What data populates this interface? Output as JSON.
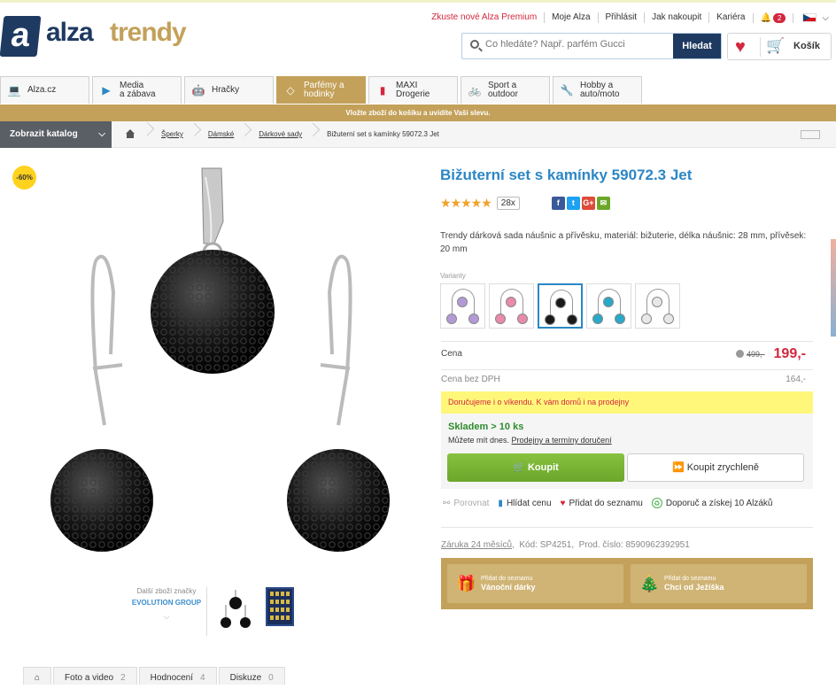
{
  "header": {
    "logo_letter": "a",
    "logo_word1": "alza",
    "logo_word2": "trendy",
    "links": [
      "Zkuste nové Alza Premium",
      "Moje Alza",
      "Přihlásit",
      "Jak nakoupit",
      "Kariéra"
    ],
    "notif_count": "2",
    "search_placeholder": "Co hledáte? Např. parfém Gucci",
    "search_button": "Hledat",
    "cart_label": "Košík"
  },
  "categories": [
    {
      "label": "Alza.cz",
      "icon": "laptop-icon",
      "color": "#1f3a60"
    },
    {
      "label": "Media\na zábava",
      "icon": "play-icon",
      "color": "#2b87c5"
    },
    {
      "label": "Hračky",
      "icon": "robot-icon",
      "color": "#e67e22"
    },
    {
      "label": "Parfémy a\nhodinky",
      "icon": "diamond-icon",
      "color": "#ffffff"
    },
    {
      "label": "MAXI\nDrogerie",
      "icon": "spray-icon",
      "color": "#d3273e"
    },
    {
      "label": "Sport a\noutdoor",
      "icon": "bike-icon",
      "color": "#6ca62a"
    },
    {
      "label": "Hobby a\nauto/moto",
      "icon": "drill-icon",
      "color": "#8b4513"
    }
  ],
  "active_category": 3,
  "promo": "Vložte zboží do košíku a uvidíte Vaši slevu.",
  "catalog_button": "Zobrazit katalog",
  "breadcrumbs": [
    "Šperky",
    "Dámské",
    "Dárkové sady",
    "Bižuterní set s kamínky 59072.3 Jet"
  ],
  "discount_badge": "-60%",
  "product": {
    "title": "Bižuterní set s kamínky 59072.3 Jet",
    "rating_count": "28x",
    "rating_stars": 5,
    "description": "Trendy dárková sada náušnic a přívěsku, materiál: bižuterie, délka náušnic: 28 mm, přívěsek: 20 mm",
    "variants_label": "Varianty",
    "variants": [
      {
        "color": "#b39ad6"
      },
      {
        "color": "#e98aa8"
      },
      {
        "color": "#1a1a1a"
      },
      {
        "color": "#2aa8c8"
      },
      {
        "color": "#e8e8e8"
      }
    ],
    "selected_variant": 2,
    "price_label": "Cena",
    "old_price": "499,-",
    "price": "199,-",
    "price_novat_label": "Cena bez DPH",
    "price_novat": "164,-",
    "delivery_note": "Doručujeme i o víkendu. K vám domů i na prodejny",
    "stock": "Skladem > 10 ks",
    "pickup_text": "Můžete mít dnes.",
    "pickup_link": "Prodejny a termíny doručení",
    "buy_button": "Koupit",
    "quick_buy_button": "Koupit zrychleně",
    "actions": {
      "compare": "Porovnat",
      "watch_price": "Hlídat cenu",
      "add_list": "Přidat do seznamu",
      "recommend": "Doporuč a získej 10 Alzáků"
    },
    "warranty": "Záruka 24 měsíců",
    "code": "Kód: SP4251",
    "prod_number": "Prod. číslo: 8590962392951",
    "lists": [
      {
        "small": "Přidat do seznamu",
        "main": "Vánoční dárky",
        "icon": "gift-icon"
      },
      {
        "small": "Přidat do seznamu",
        "main": "Chci od Ježíška",
        "icon": "tree-icon"
      }
    ]
  },
  "brand": {
    "label": "Další zboží značky",
    "name": "EVOLUTION GROUP"
  },
  "tabs": [
    {
      "label": "Foto a video",
      "count": "2"
    },
    {
      "label": "Hodnocení",
      "count": "4"
    },
    {
      "label": "Diskuze",
      "count": "0"
    }
  ]
}
